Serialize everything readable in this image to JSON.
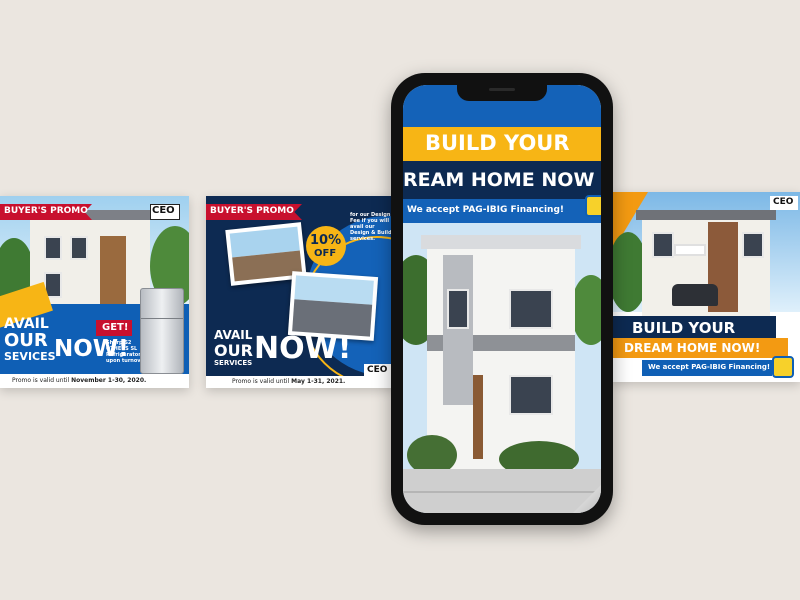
{
  "colors": {
    "background": "#ebe6e0",
    "navy": "#0d2a52",
    "blue": "#0f5fb5",
    "yellow": "#f7b515",
    "red": "#c8102e",
    "orange": "#f39a12"
  },
  "card1": {
    "ribbon": "BUYER'S PROMO",
    "logo": "CEO",
    "avail": "AVAIL",
    "our": "OUR",
    "services": "SEVICES",
    "now": "NOW!",
    "get": "GET!",
    "gift_lines": [
      "Sharp S2",
      "OTHERS SL",
      "Refrigerator",
      "upon turnover"
    ],
    "footer_prefix": "Promo is valid until ",
    "footer_date": "November 1-30, 2020."
  },
  "card2": {
    "ribbon": "BUYER'S PROMO",
    "badge_pct": "10%",
    "badge_off": "OFF",
    "blurb_lines": [
      "for our Design",
      "Fee if you will",
      "avail our",
      "Design & Build",
      "services."
    ],
    "avail": "AVAIL",
    "our": "OUR",
    "services": "SERVICES",
    "now": "NOW!",
    "logo": "CEO",
    "footer_prefix": "Promo is valid until ",
    "footer_date": "May 1-31, 2021."
  },
  "phone": {
    "headline1": "BUILD YOUR",
    "headline2": "REAM HOME NOW",
    "pagibig": "We accept PAG-IBIG Financing!"
  },
  "card3": {
    "logo": "CEO",
    "headline1": "BUILD YOUR",
    "headline2": "DREAM HOME NOW!",
    "pagibig": "We accept PAG-IBIG Financing!"
  }
}
